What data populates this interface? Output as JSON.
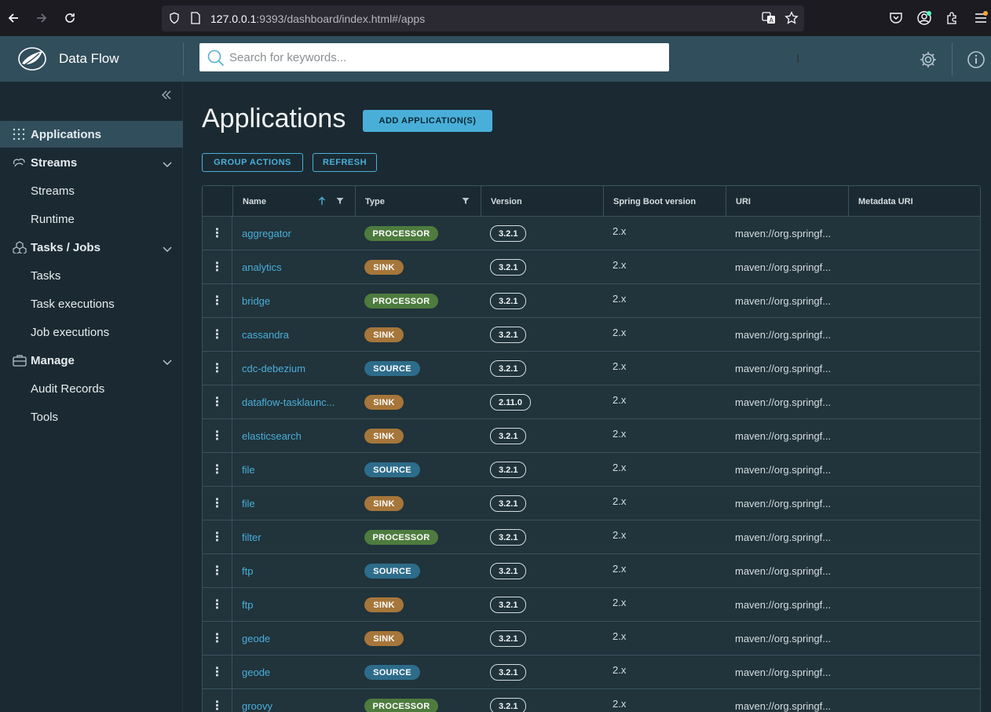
{
  "browser": {
    "url_host": "127.0.0.1",
    "url_rest": ":9393/dashboard/index.html#/apps"
  },
  "header": {
    "brand": "Data Flow",
    "search_placeholder": "Search for keywords..."
  },
  "sidebar": {
    "items": [
      {
        "label": "Applications"
      },
      {
        "label": "Streams"
      },
      {
        "label": "Streams"
      },
      {
        "label": "Runtime"
      },
      {
        "label": "Tasks / Jobs"
      },
      {
        "label": "Tasks"
      },
      {
        "label": "Task executions"
      },
      {
        "label": "Job executions"
      },
      {
        "label": "Manage"
      },
      {
        "label": "Audit Records"
      },
      {
        "label": "Tools"
      }
    ]
  },
  "main": {
    "title": "Applications",
    "add_button": "ADD APPLICATION(S)",
    "group_actions": "GROUP ACTIONS",
    "refresh": "REFRESH",
    "columns": [
      "Name",
      "Type",
      "Version",
      "Spring Boot version",
      "URI",
      "Metadata URI"
    ],
    "rows": [
      {
        "name": "aggregator",
        "type": "PROCESSOR",
        "version": "3.2.1",
        "boot": "2.x",
        "uri": "maven://org.springf..."
      },
      {
        "name": "analytics",
        "type": "SINK",
        "version": "3.2.1",
        "boot": "2.x",
        "uri": "maven://org.springf..."
      },
      {
        "name": "bridge",
        "type": "PROCESSOR",
        "version": "3.2.1",
        "boot": "2.x",
        "uri": "maven://org.springf..."
      },
      {
        "name": "cassandra",
        "type": "SINK",
        "version": "3.2.1",
        "boot": "2.x",
        "uri": "maven://org.springf..."
      },
      {
        "name": "cdc-debezium",
        "type": "SOURCE",
        "version": "3.2.1",
        "boot": "2.x",
        "uri": "maven://org.springf..."
      },
      {
        "name": "dataflow-tasklaunc...",
        "type": "SINK",
        "version": "2.11.0",
        "boot": "2.x",
        "uri": "maven://org.springf..."
      },
      {
        "name": "elasticsearch",
        "type": "SINK",
        "version": "3.2.1",
        "boot": "2.x",
        "uri": "maven://org.springf..."
      },
      {
        "name": "file",
        "type": "SOURCE",
        "version": "3.2.1",
        "boot": "2.x",
        "uri": "maven://org.springf..."
      },
      {
        "name": "file",
        "type": "SINK",
        "version": "3.2.1",
        "boot": "2.x",
        "uri": "maven://org.springf..."
      },
      {
        "name": "filter",
        "type": "PROCESSOR",
        "version": "3.2.1",
        "boot": "2.x",
        "uri": "maven://org.springf..."
      },
      {
        "name": "ftp",
        "type": "SOURCE",
        "version": "3.2.1",
        "boot": "2.x",
        "uri": "maven://org.springf..."
      },
      {
        "name": "ftp",
        "type": "SINK",
        "version": "3.2.1",
        "boot": "2.x",
        "uri": "maven://org.springf..."
      },
      {
        "name": "geode",
        "type": "SINK",
        "version": "3.2.1",
        "boot": "2.x",
        "uri": "maven://org.springf..."
      },
      {
        "name": "geode",
        "type": "SOURCE",
        "version": "3.2.1",
        "boot": "2.x",
        "uri": "maven://org.springf..."
      },
      {
        "name": "groovy",
        "type": "PROCESSOR",
        "version": "3.2.1",
        "boot": "2.x",
        "uri": "maven://org.springf..."
      }
    ]
  }
}
